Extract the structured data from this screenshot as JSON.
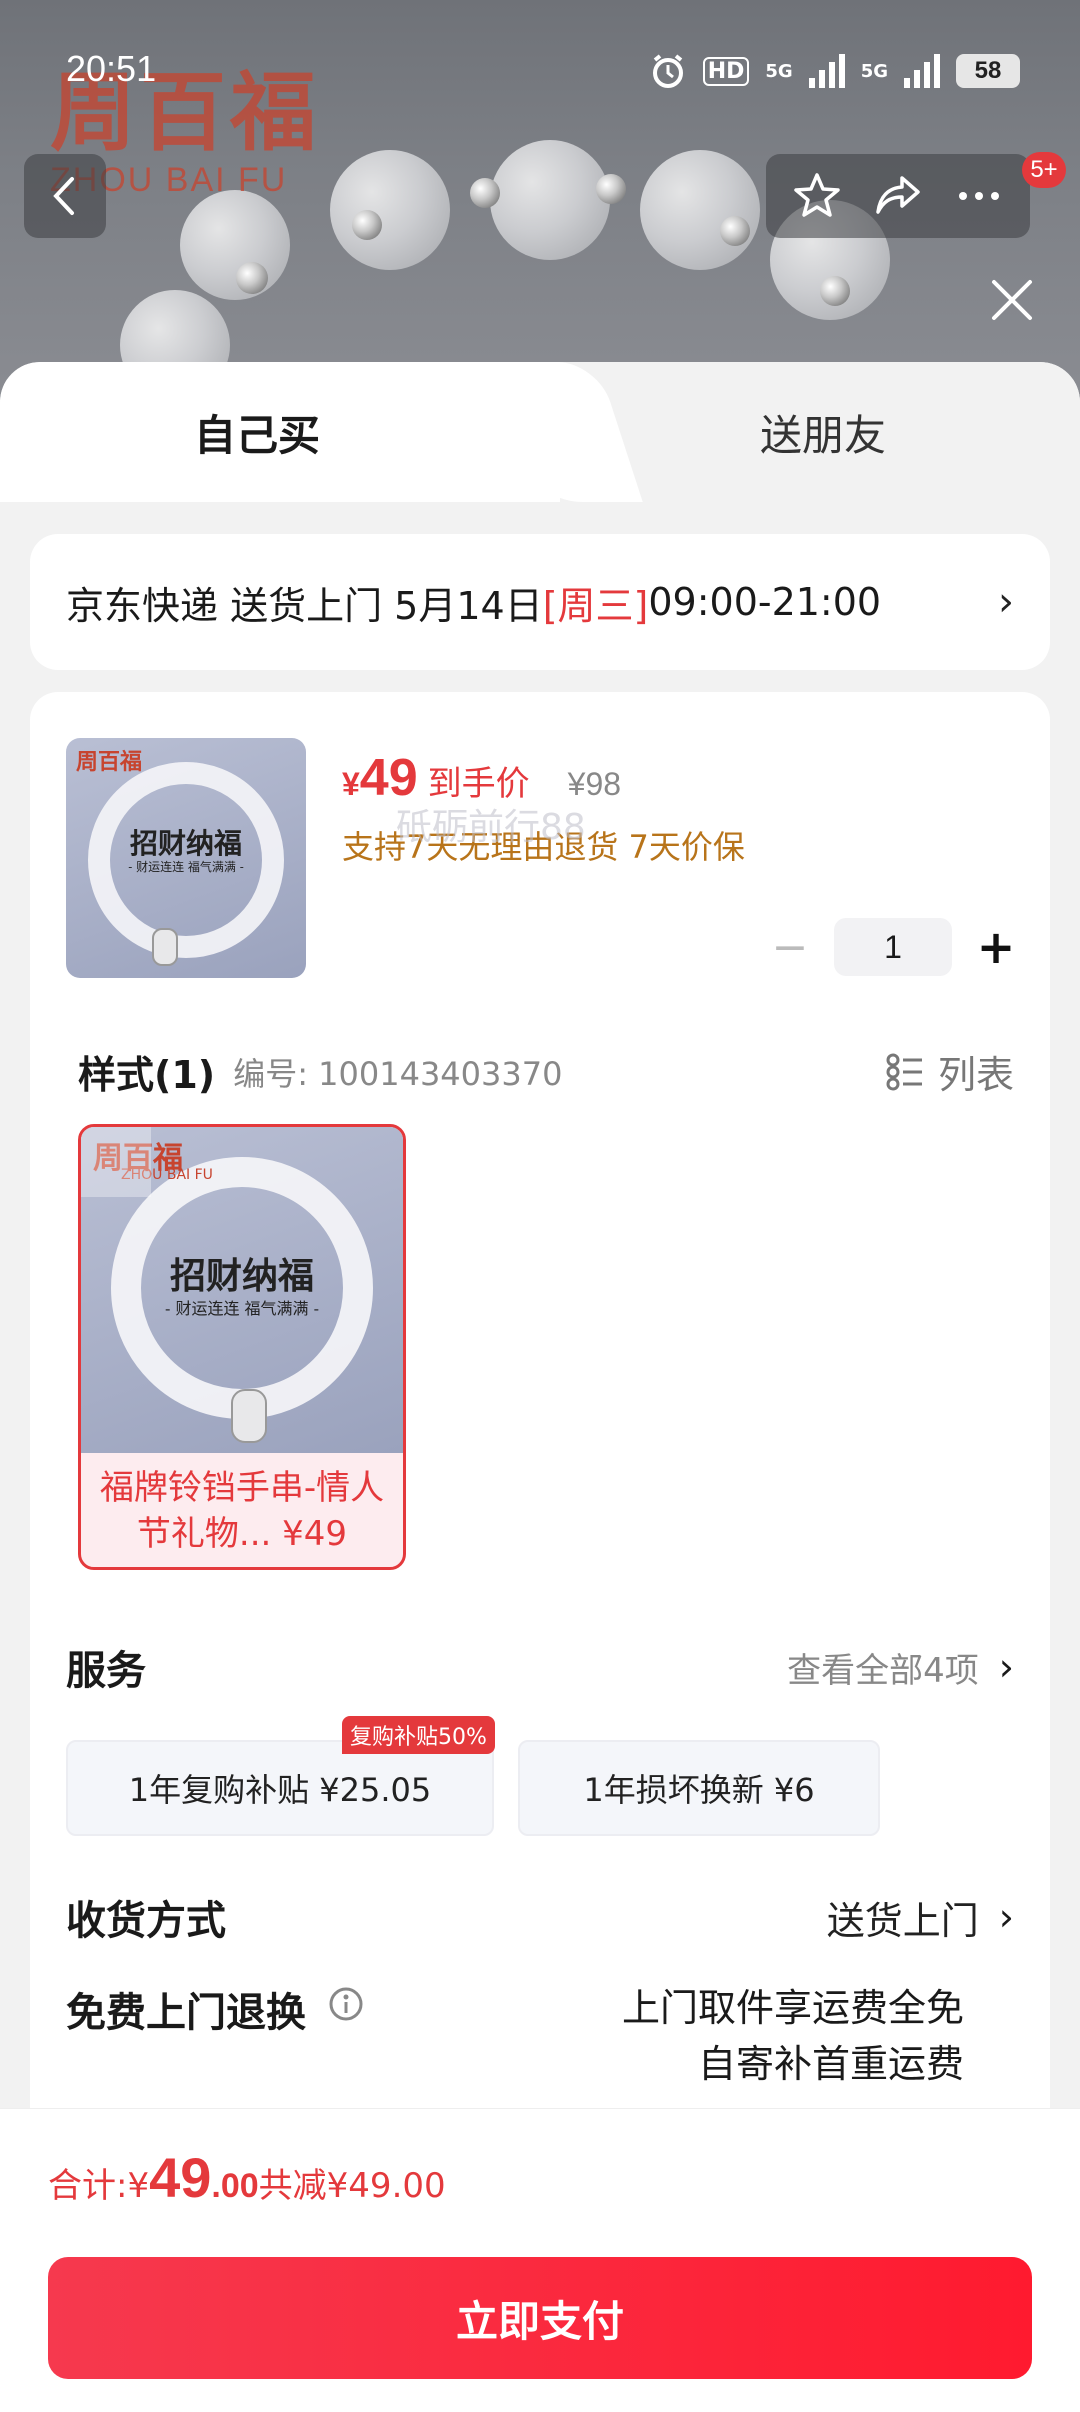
{
  "status_bar": {
    "time": "20:51",
    "hd_label": "HD",
    "net1": "5G",
    "net2": "5G",
    "battery": "58"
  },
  "backdrop": {
    "brand_cn": "周百福",
    "brand_en": "ZHOU BAI FU",
    "notification_count": "5+"
  },
  "tabs": {
    "self": "自己买",
    "gift": "送朋友"
  },
  "delivery": {
    "prefix": "京东快递 送货上门 5月14日 ",
    "weekday": "[周三]",
    "time_window": " 09:00-21:00"
  },
  "product": {
    "image_brand": "周百福",
    "image_title": "招财纳福",
    "image_subtitle": "- 财运连连 福气满满 -",
    "price_symbol": "¥",
    "price": "49",
    "price_label": "到手价",
    "original_price": "¥98",
    "promise": "支持7天无理由退货  7天价保",
    "quantity": "1",
    "minus_label": "−",
    "plus_label": "+"
  },
  "style": {
    "title": "样式(1)",
    "code": "编号: 100143403370",
    "list_label": "列表",
    "sku_name": "福牌铃铛手串-情人节礼物... ¥49",
    "sku_brand": "周百福",
    "sku_brand_en": "ZHOU BAI FU",
    "watermark": "砥砺前行88"
  },
  "services": {
    "title": "服务",
    "view_all": "查看全部4项",
    "items": [
      {
        "label": "1年复购补贴  ¥25.05",
        "badge": "复购补贴50%"
      },
      {
        "label": "1年损坏换新  ¥6"
      }
    ]
  },
  "shipping": {
    "title": "收货方式",
    "value": "送货上门"
  },
  "returns": {
    "title": "免费上门退换",
    "line1": "上门取件享运费全免",
    "line2": "自寄补首重运费"
  },
  "footer": {
    "total_label": "合计: ",
    "currency": "¥",
    "total_int": "49",
    "total_dec": ".00",
    "saving": " 共减¥49.00",
    "pay_button": "立即支付"
  },
  "colors": {
    "accent": "#e4393c",
    "promise": "#b8741a",
    "sheet_bg": "#f2f2f2"
  }
}
